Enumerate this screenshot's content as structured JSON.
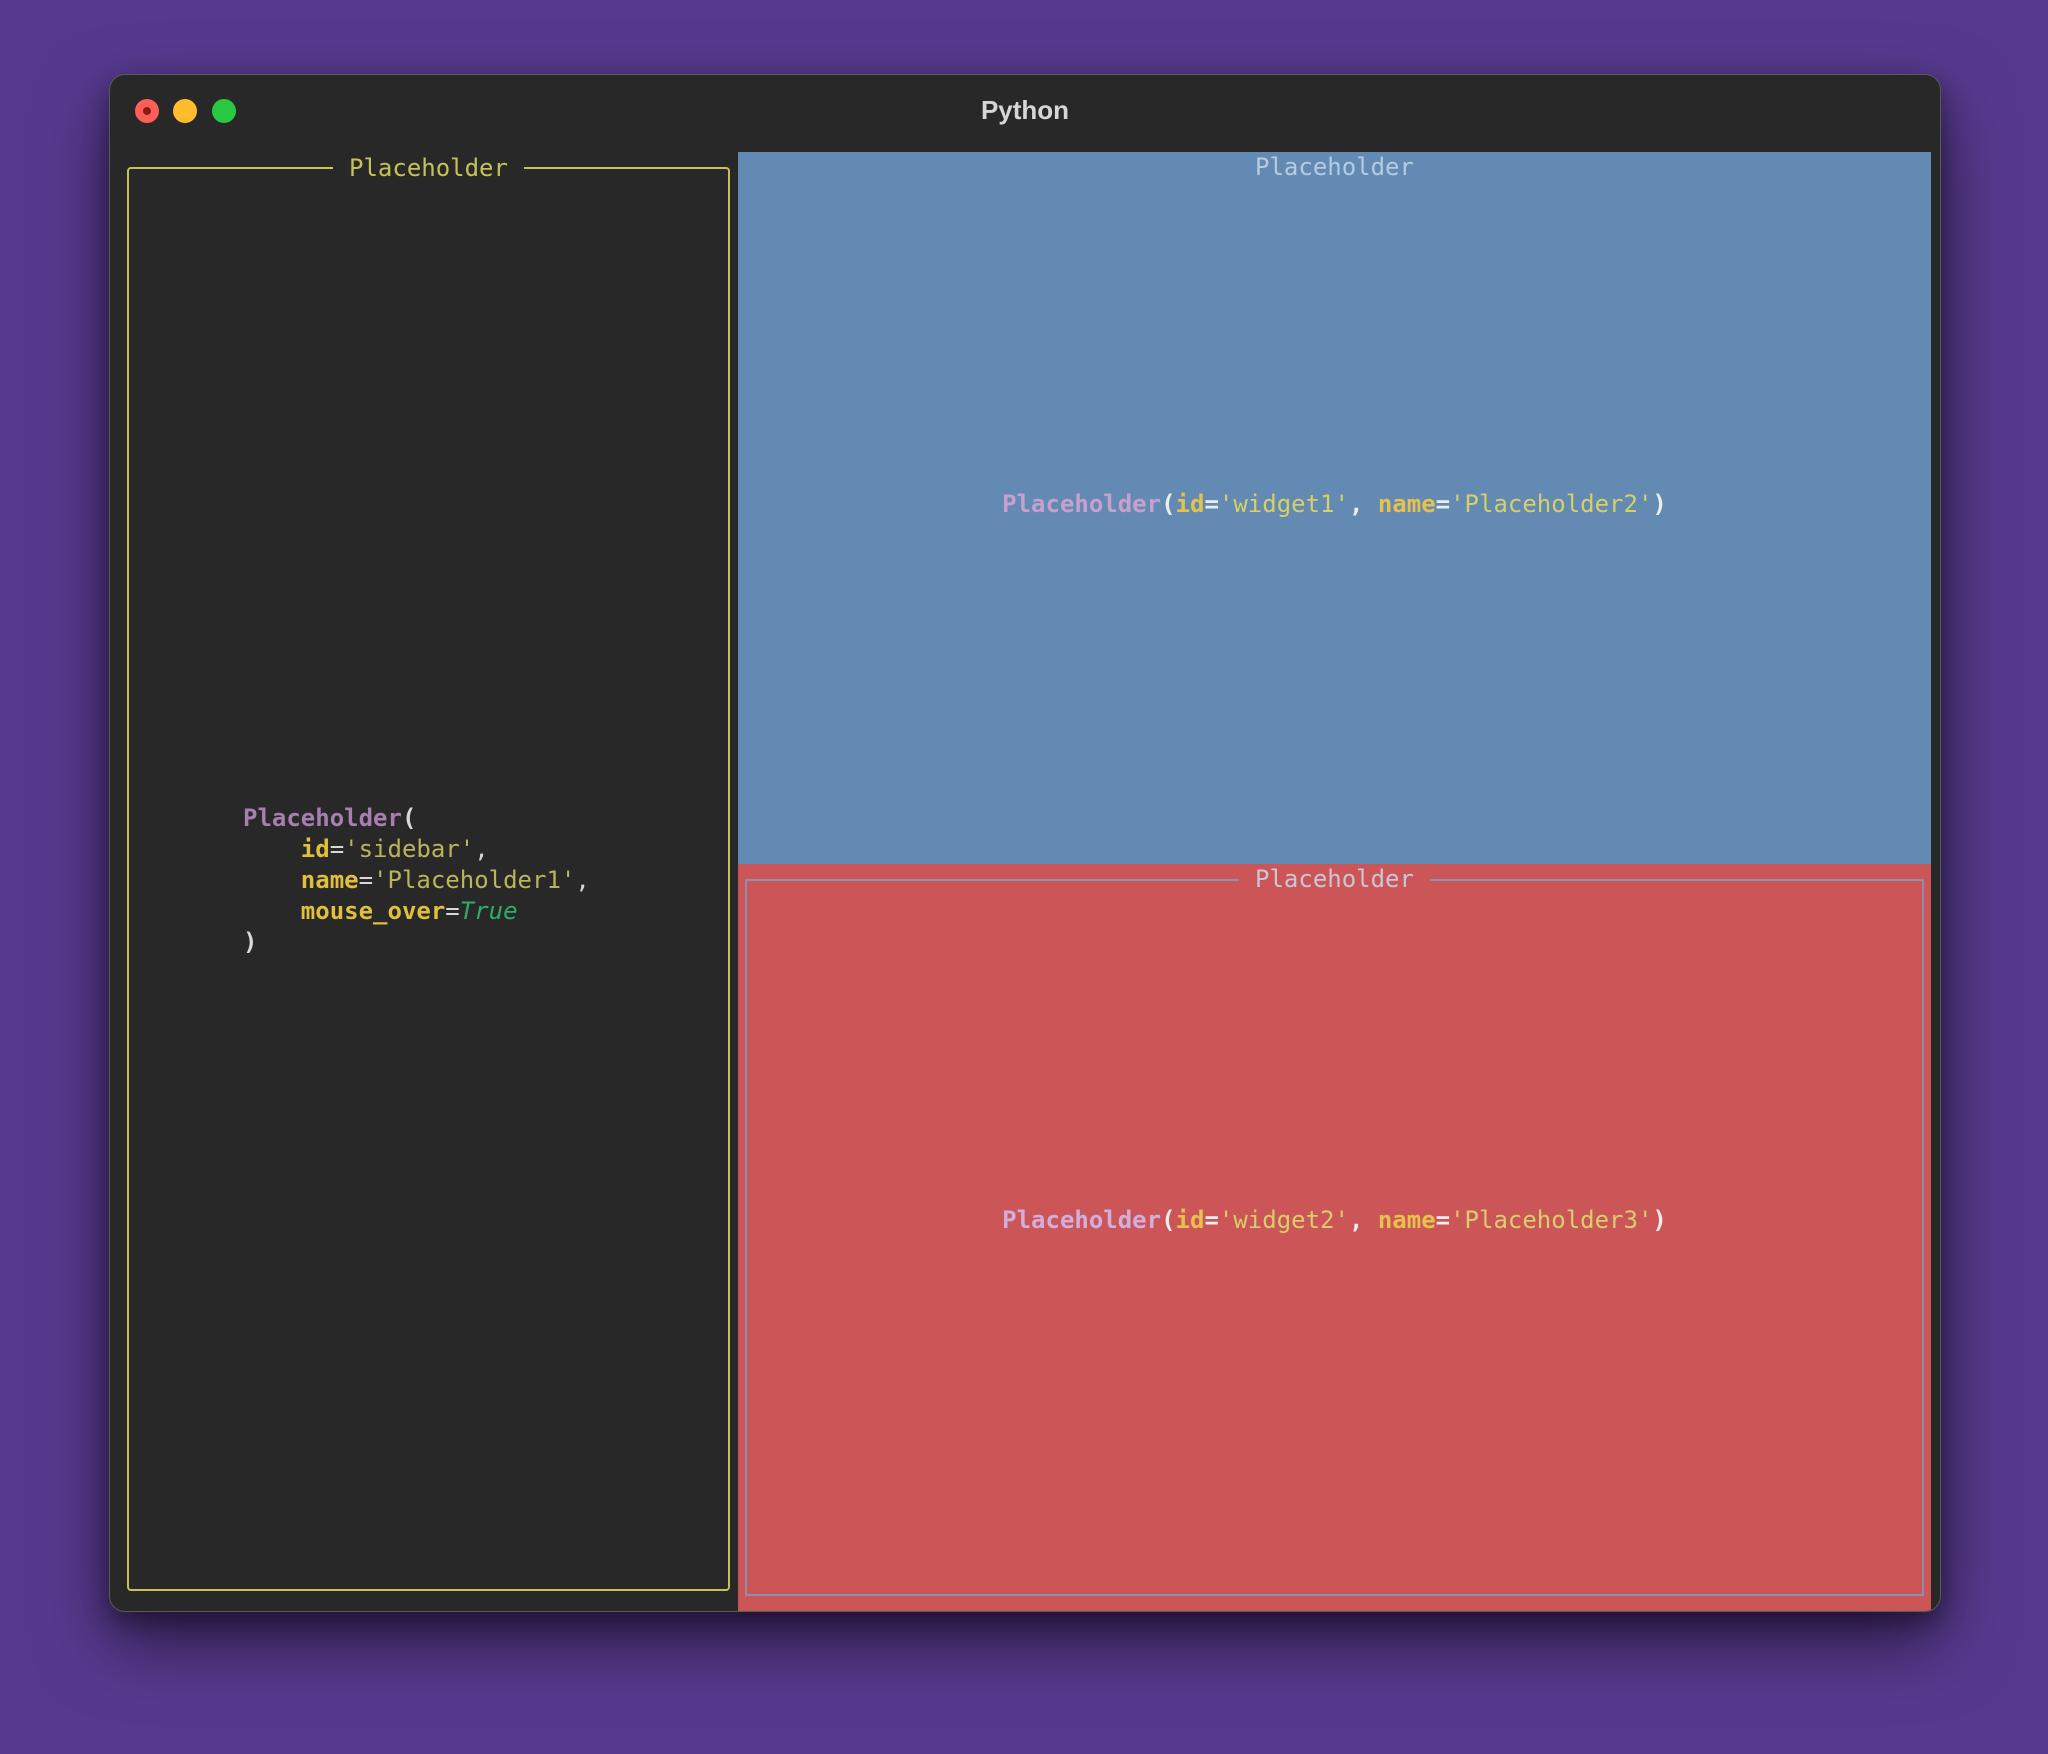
{
  "window": {
    "title": "Python",
    "controls": [
      "close",
      "minimize",
      "maximize"
    ]
  },
  "sidebar": {
    "title": "Placeholder",
    "code": {
      "class_name": "Placeholder",
      "open_paren": "(",
      "close_paren": ")",
      "args": [
        {
          "key": "id",
          "value": "'sidebar'",
          "suffix": ","
        },
        {
          "key": "name",
          "value": "'Placeholder1'",
          "suffix": ","
        },
        {
          "key": "mouse_over",
          "value": "True",
          "suffix": ""
        }
      ]
    }
  },
  "widget1": {
    "title": "Placeholder",
    "repr": {
      "class_name": "Placeholder",
      "open_paren": "(",
      "close_paren": ")",
      "id_key": "id",
      "id_value": "'widget1'",
      "sep": ", ",
      "name_key": "name",
      "name_value": "'Placeholder2'"
    }
  },
  "widget2": {
    "title": "Placeholder",
    "repr": {
      "class_name": "Placeholder",
      "open_paren": "(",
      "close_paren": ")",
      "id_key": "id",
      "id_value": "'widget2'",
      "sep": ", ",
      "name_key": "name",
      "name_value": "'Placeholder3'"
    }
  },
  "colors": {
    "background": "#573a8f",
    "window": "#282828",
    "sidebar_border": "#c7c255",
    "widget1_bg": "#628ab2",
    "widget2_bg": "#cc5558",
    "widget2_border": "#8c8fae"
  }
}
